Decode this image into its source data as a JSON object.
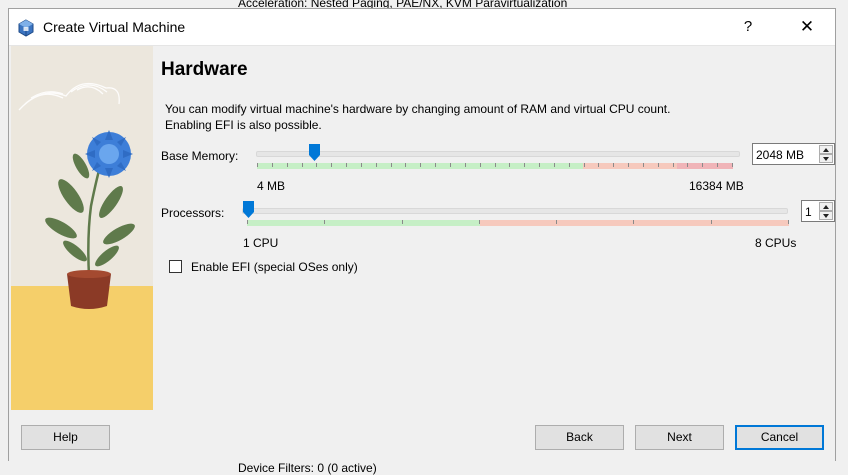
{
  "background": {
    "top_text": "Acceleration:     Nested Paging, PAE/NX, KVM Paravirtualization",
    "bottom_text": "Device Filters:     0 (0 active)"
  },
  "window": {
    "title": "Create Virtual Machine",
    "help_glyph": "?",
    "close_glyph": "✕"
  },
  "page": {
    "heading": "Hardware",
    "description_line1": "You can modify virtual machine's hardware by changing amount of RAM and virtual CPU count.",
    "description_line2": "Enabling EFI is also possible."
  },
  "memory": {
    "label": "Base Memory:",
    "value": "2048 MB",
    "min_label": "4 MB",
    "max_label": "16384 MB",
    "fraction": 0.12
  },
  "processors": {
    "label": "Processors:",
    "value": "1",
    "min_label": "1 CPU",
    "max_label": "8 CPUs",
    "fraction": 0
  },
  "efi": {
    "label": "Enable EFI (special OSes only)",
    "checked": false
  },
  "buttons": {
    "help": "Help",
    "back": "Back",
    "next": "Next",
    "cancel": "Cancel"
  },
  "colors": {
    "accent": "#0078d7",
    "ok_range": "#c6efc6",
    "warn_range": "#f6c9bd",
    "danger_range": "#f0b4b8"
  }
}
